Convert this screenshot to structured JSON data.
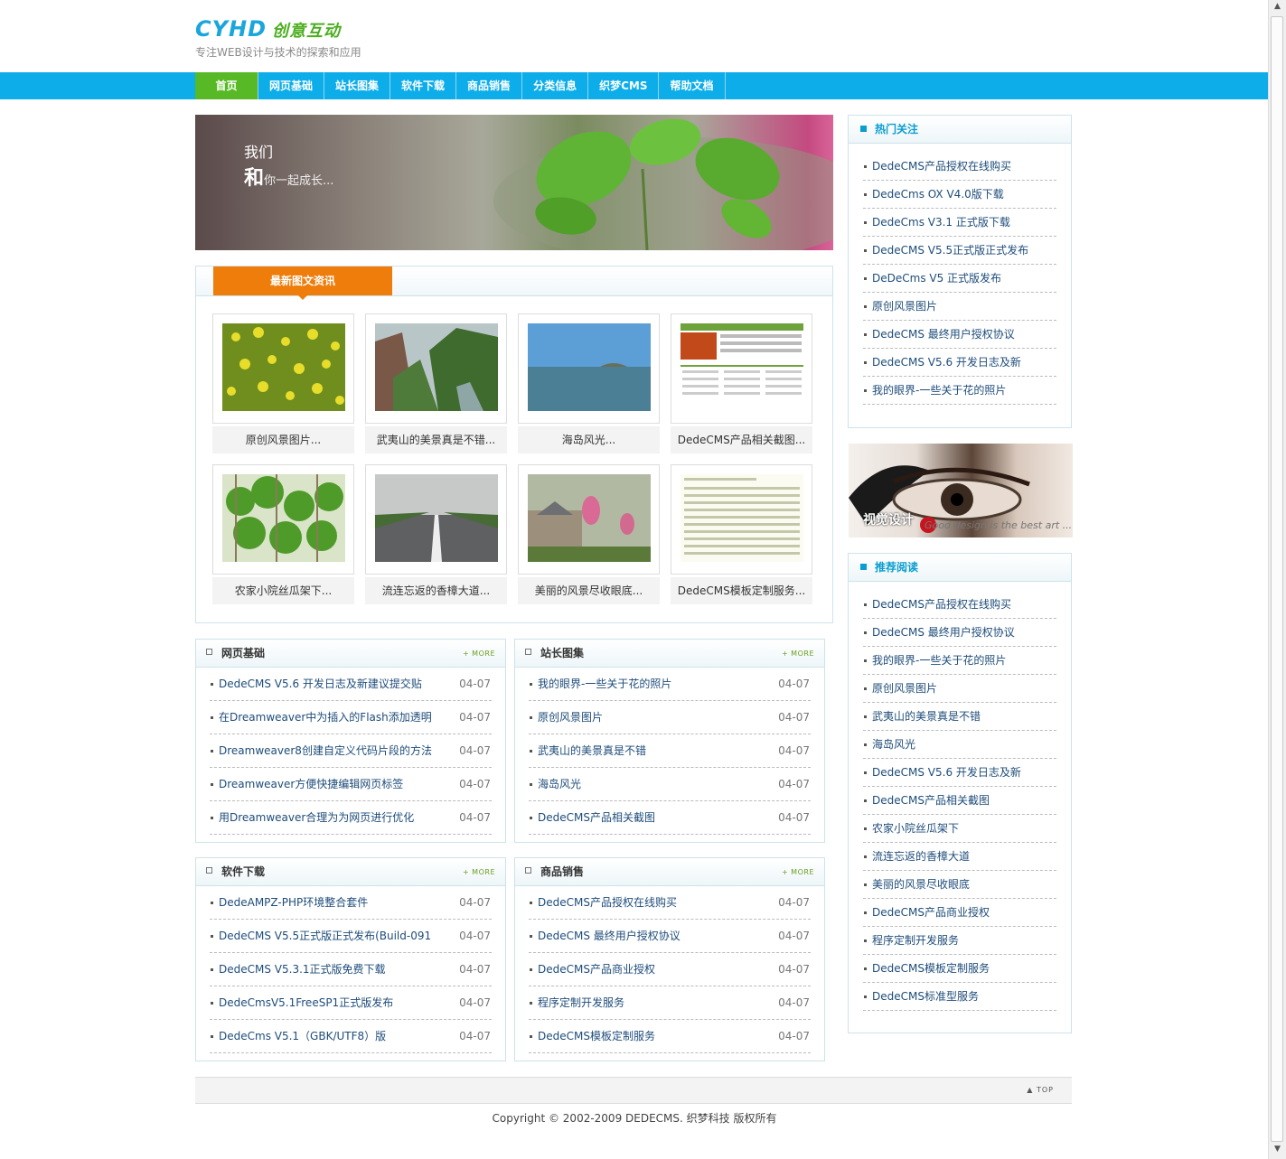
{
  "header": {
    "logo_en": "CYHD",
    "logo_cn": "创意互动",
    "tagline": "专注WEB设计与技术的探索和应用"
  },
  "nav": [
    "首页",
    "网页基础",
    "站长图集",
    "软件下载",
    "商品销售",
    "分类信息",
    "织梦CMS",
    "帮助文档"
  ],
  "banner": {
    "line1": "我们",
    "line2_big": "和",
    "line2_rest": "你一起成长..."
  },
  "pictures": {
    "title": "最新图文资讯",
    "items": [
      {
        "caption": "原创风景图片...",
        "img": "rapeseed-flowers"
      },
      {
        "caption": "武夷山的美景真是不错...",
        "img": "mountain-valley"
      },
      {
        "caption": "海岛风光...",
        "img": "sea-island"
      },
      {
        "caption": "DedeCMS产品相关截图...",
        "img": "website-screenshot"
      },
      {
        "caption": "农家小院丝瓜架下...",
        "img": "vegetable-trellis"
      },
      {
        "caption": "流连忘返的香樟大道...",
        "img": "tree-lined-road"
      },
      {
        "caption": "美丽的风景尽收眼底...",
        "img": "magnolia-buds"
      },
      {
        "caption": "DedeCMS模板定制服务...",
        "img": "document-screenshot"
      }
    ]
  },
  "more_label": "+ MORE",
  "news": [
    {
      "title": "网页基础",
      "items": [
        {
          "text": "DedeCMS V5.6 开发日志及新建议提交贴",
          "date": "04-07"
        },
        {
          "text": "在Dreamweaver中为插入的Flash添加透明",
          "date": "04-07"
        },
        {
          "text": "Dreamweaver8创建自定义代码片段的方法",
          "date": "04-07"
        },
        {
          "text": "Dreamweaver方便快捷编辑网页标签",
          "date": "04-07"
        },
        {
          "text": "用Dreamweaver合理为为网页进行优化",
          "date": "04-07"
        }
      ]
    },
    {
      "title": "站长图集",
      "items": [
        {
          "text": "我的眼界-一些关于花的照片",
          "date": "04-07"
        },
        {
          "text": "原创风景图片",
          "date": "04-07"
        },
        {
          "text": "武夷山的美景真是不错",
          "date": "04-07"
        },
        {
          "text": "海岛风光",
          "date": "04-07"
        },
        {
          "text": "DedeCMS产品相关截图",
          "date": "04-07"
        }
      ]
    },
    {
      "title": "软件下载",
      "items": [
        {
          "text": "DedeAMPZ-PHP环境整合套件",
          "date": "04-07"
        },
        {
          "text": "DedeCMS V5.5正式版正式发布(Build-091",
          "date": "04-07"
        },
        {
          "text": "DedeCMS V5.3.1正式版免费下载",
          "date": "04-07"
        },
        {
          "text": "DedeCmsV5.1FreeSP1正式版发布",
          "date": "04-07"
        },
        {
          "text": "DedeCms V5.1（GBK/UTF8）版",
          "date": "04-07"
        }
      ]
    },
    {
      "title": "商品销售",
      "items": [
        {
          "text": "DedeCMS产品授权在线购买",
          "date": "04-07"
        },
        {
          "text": "DedeCMS 最终用户授权协议",
          "date": "04-07"
        },
        {
          "text": "DedeCMS产品商业授权",
          "date": "04-07"
        },
        {
          "text": "程序定制开发服务",
          "date": "04-07"
        },
        {
          "text": "DedeCMS模板定制服务",
          "date": "04-07"
        }
      ]
    }
  ],
  "hot": {
    "title": "热门关注",
    "items": [
      "DedeCMS产品授权在线购买",
      "DedeCms OX V4.0版下载",
      "DedeCms V3.1 正式版下载",
      "DedeCMS V5.5正式版正式发布",
      "DeDeCms V5 正式版发布",
      "原创风景图片",
      "DedeCMS 最终用户授权协议",
      "DedeCMS V5.6 开发日志及新",
      "我的眼界-一些关于花的照片"
    ]
  },
  "ad": {
    "text_cn": "视觉设计",
    "text_en": "Good design is the best art ..."
  },
  "recommend": {
    "title": "推荐阅读",
    "items": [
      "DedeCMS产品授权在线购买",
      "DedeCMS 最终用户授权协议",
      "我的眼界-一些关于花的照片",
      "原创风景图片",
      "武夷山的美景真是不错",
      "海岛风光",
      "DedeCMS V5.6 开发日志及新",
      "DedeCMS产品相关截图",
      "农家小院丝瓜架下",
      "流连忘返的香樟大道",
      "美丽的风景尽收眼底",
      "DedeCMS产品商业授权",
      "程序定制开发服务",
      "DedeCMS模板定制服务",
      "DedeCMS标准型服务"
    ]
  },
  "footer": {
    "top_label": "▲ TOP",
    "copyright": "Copyright © 2002-2009 DEDECMS. 织梦科技 版权所有"
  }
}
